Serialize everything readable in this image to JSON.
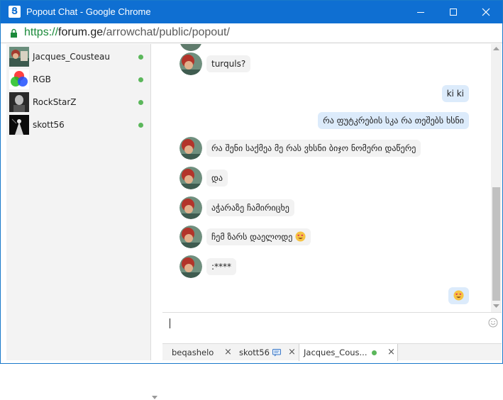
{
  "window": {
    "title": "Popout Chat - Google Chrome",
    "app_icon_glyph": "Ց"
  },
  "address": {
    "scheme": "https://",
    "host": "forum.ge",
    "path": "/arrowchat/public/popout/"
  },
  "buddies": [
    {
      "name": "Jacques_Cousteau",
      "status": "online"
    },
    {
      "name": "RGB",
      "status": "online"
    },
    {
      "name": "RockStarZ",
      "status": "online"
    },
    {
      "name": "skott56",
      "status": "online"
    }
  ],
  "messages": [
    {
      "dir": "in",
      "text": "turquls?"
    },
    {
      "dir": "out",
      "text": "ki ki"
    },
    {
      "dir": "out",
      "text": "რა ფუტკრების სკა რა თეშებს ხსნი"
    },
    {
      "dir": "in",
      "text": "რა შენი საქმეა მე რას ვხსნი ბიჯო ნომერი დაწერე"
    },
    {
      "dir": "in",
      "text": "და"
    },
    {
      "dir": "in",
      "text": "აჭარაზე ჩამირიცხე"
    },
    {
      "dir": "in",
      "text": "ჩემ ზარს დაელოდე",
      "emoji": "heart-eyes"
    },
    {
      "dir": "in",
      "text": ":****"
    },
    {
      "dir": "out",
      "text": "",
      "emoji": "heart-eyes"
    }
  ],
  "composer": {
    "value": ""
  },
  "tabs": [
    {
      "label": "beqashelo",
      "active": false,
      "close": "×"
    },
    {
      "label": "skott56",
      "active": false,
      "close": "×",
      "badge": "new-message-icon"
    },
    {
      "label": "Jacques_Cous...",
      "active": true,
      "close": "×",
      "badge": "online-dot"
    }
  ],
  "colors": {
    "titlebar": "#0f6fd2",
    "online": "#5bb75b",
    "bubble_out": "#dcebfb",
    "bubble_in": "#f2f2f2"
  }
}
